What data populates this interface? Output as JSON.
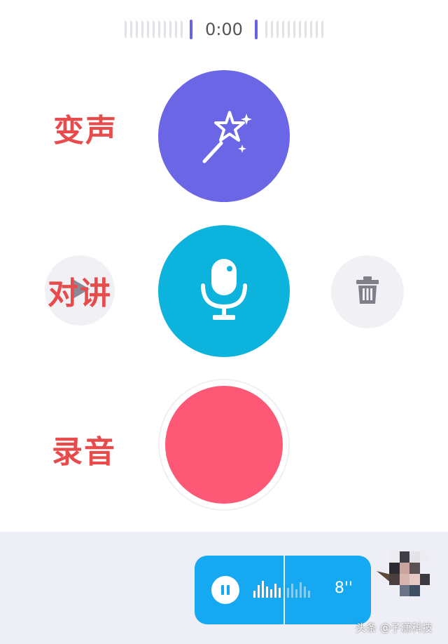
{
  "timer": {
    "elapsed": "0:00"
  },
  "annotations": {
    "voice_changer": "变声",
    "walkie_talkie": "对讲",
    "record": "录音"
  },
  "icons": {
    "voice_changer": "magic-wand-icon",
    "talk": "microphone-icon",
    "play": "play-icon",
    "delete": "trash-icon",
    "pause": "pause-icon"
  },
  "message": {
    "duration": "8''"
  },
  "watermark": "头条 @子潇科技",
  "colors": {
    "voice_changer": "#6a66e6",
    "talk": "#0cb4dd",
    "record": "#fd5875",
    "bubble": "#17a8f2",
    "annotation": "#e74b4b",
    "panel": "#eeeef6"
  }
}
